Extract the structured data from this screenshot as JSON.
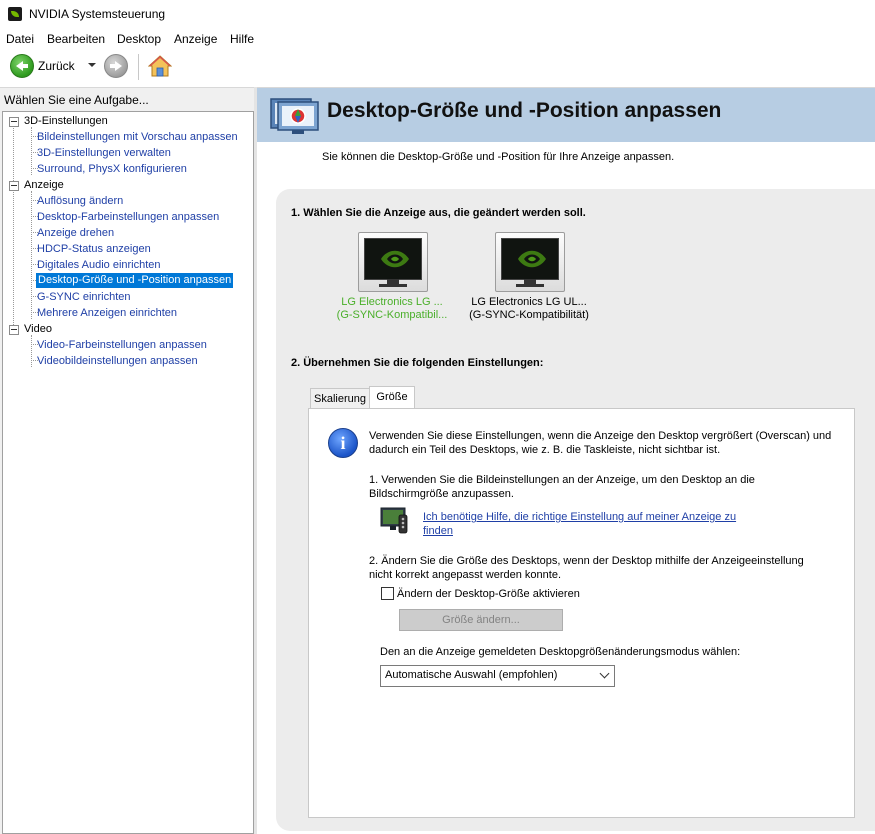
{
  "window": {
    "title": "NVIDIA Systemsteuerung"
  },
  "menu": [
    "Datei",
    "Bearbeiten",
    "Desktop",
    "Anzeige",
    "Hilfe"
  ],
  "toolbar": {
    "back_label": "Zurück"
  },
  "sidebar": {
    "header": "Wählen Sie eine Aufgabe...",
    "categories": [
      {
        "label": "3D-Einstellungen",
        "items": [
          "Bildeinstellungen mit Vorschau anpassen",
          "3D-Einstellungen verwalten",
          "Surround, PhysX konfigurieren"
        ]
      },
      {
        "label": "Anzeige",
        "items": [
          "Auflösung ändern",
          "Desktop-Farbeinstellungen anpassen",
          "Anzeige drehen",
          "HDCP-Status anzeigen",
          "Digitales Audio einrichten",
          "Desktop-Größe und -Position anpassen",
          "G-SYNC einrichten",
          "Mehrere Anzeigen einrichten"
        ]
      },
      {
        "label": "Video",
        "items": [
          "Video-Farbeinstellungen anpassen",
          "Videobildeinstellungen anpassen"
        ]
      }
    ],
    "selected": "Desktop-Größe und -Position anpassen"
  },
  "page": {
    "title": "Desktop-Größe und -Position anpassen",
    "subtitle": "Sie können die Desktop-Größe und -Position für Ihre Anzeige anpassen.",
    "section1": "1. Wählen Sie die Anzeige aus, die geändert werden soll.",
    "displays": [
      {
        "line1": "LG Electronics LG ...",
        "line2": "(G-SYNC-Kompatibil...",
        "selected": true
      },
      {
        "line1": "LG Electronics LG UL...",
        "line2": "(G-SYNC-Kompatibilität)",
        "selected": false
      }
    ],
    "section2": "2. Übernehmen Sie die folgenden Einstellungen:",
    "tabs": [
      "Skalierung",
      "Größe"
    ],
    "active_tab": "Größe",
    "info_text_1": "Verwenden Sie diese Einstellungen, wenn die Anzeige den Desktop vergrößert (Overscan) und",
    "info_text_2": "dadurch ein Teil des Desktops, wie z. B. die Taskleiste, nicht sichtbar ist.",
    "step1_line1": "1. Verwenden Sie die Bildeinstellungen an der Anzeige, um den Desktop an die",
    "step1_line2": "Bildschirmgröße anzupassen.",
    "help_link_1": "Ich benötige Hilfe, die richtige Einstellung auf meiner Anzeige zu",
    "help_link_2": "finden",
    "step2_line1": "2. Ändern Sie die Größe des Desktops, wenn der Desktop mithilfe der Anzeigeeinstellung",
    "step2_line2": "nicht korrekt angepasst werden konnte.",
    "checkbox_label": "Ändern der Desktop-Größe aktivieren",
    "checkbox_checked": false,
    "resize_button": "Größe ändern...",
    "mode_label": "Den an die Anzeige gemeldeten Desktopgrößenänderungsmodus wählen:",
    "mode_value": "Automatische Auswahl (empfohlen)"
  },
  "colors": {
    "accent": "#76b900",
    "banner": "#b7cde3",
    "link": "#1f3fa6",
    "selection": "#0078d7"
  }
}
